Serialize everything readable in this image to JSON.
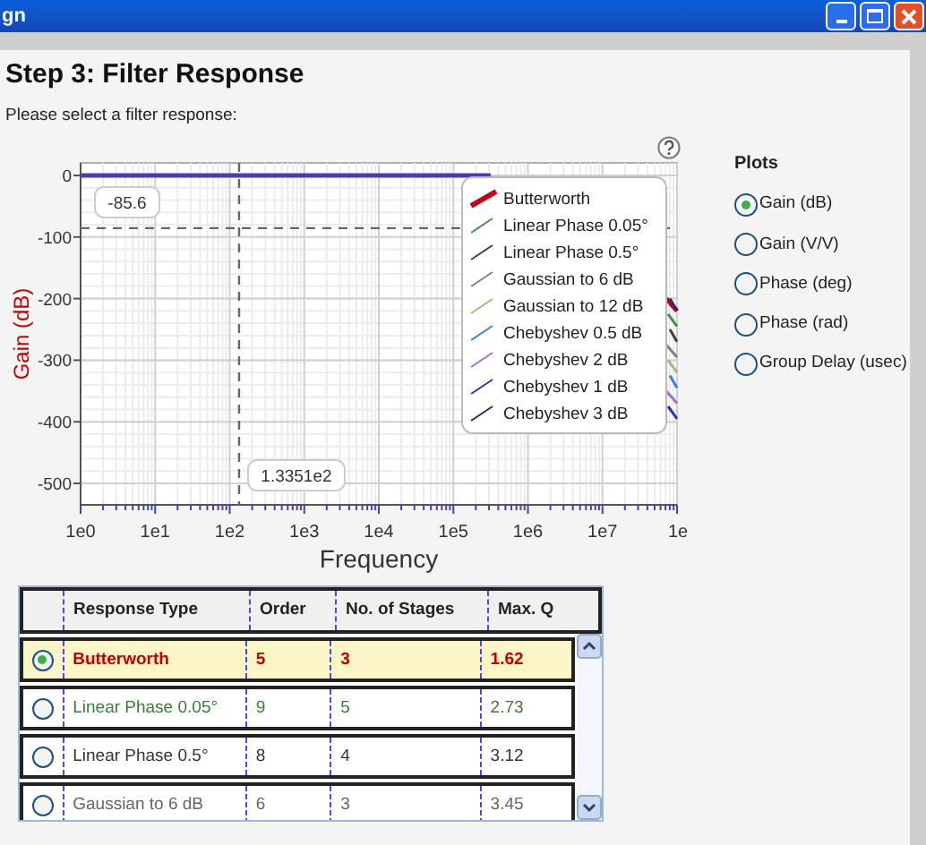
{
  "window": {
    "title": "gn"
  },
  "step_title": "Step 3: Filter Response",
  "instruction": "Please select a filter response:",
  "plot": {
    "xlabel": "Frequency",
    "ylabel": "Gain (dB)",
    "x_ticks": [
      "1e0",
      "1e1",
      "1e2",
      "1e3",
      "1e4",
      "1e5",
      "1e6",
      "1e7",
      "1e"
    ],
    "y_ticks": [
      "0",
      "-100",
      "-200",
      "-300",
      "-400",
      "-500"
    ],
    "cursor_labels": [
      "1.3351e2",
      "-85.6"
    ],
    "legend": [
      {
        "name": "Butterworth",
        "color": "#c0001a"
      },
      {
        "name": "Linear Phase 0.05°",
        "color": "#4f8a4f"
      },
      {
        "name": "Linear Phase 0.5°",
        "color": "#404040"
      },
      {
        "name": "Gaussian to 6 dB",
        "color": "#808080"
      },
      {
        "name": "Gaussian to 12 dB",
        "color": "#b8ad80"
      },
      {
        "name": "Chebyshev 0.5 dB",
        "color": "#3a7de0"
      },
      {
        "name": "Chebyshev 2 dB",
        "color": "#a070d0"
      },
      {
        "name": "Chebyshev 1 dB",
        "color": "#3030c0"
      },
      {
        "name": "Chebyshev 3 dB",
        "color": "#2a2a70"
      }
    ]
  },
  "plots": {
    "title": "Plots",
    "options": [
      {
        "label": "Gain (dB)",
        "selected": true
      },
      {
        "label": "Gain (V/V)",
        "selected": false
      },
      {
        "label": "Phase (deg)",
        "selected": false
      },
      {
        "label": "Phase (rad)",
        "selected": false
      },
      {
        "label": "Group Delay (usec)",
        "selected": false
      }
    ]
  },
  "table": {
    "columns": [
      "Response Type",
      "Order",
      "No. of Stages",
      "Max. Q"
    ],
    "rows": [
      {
        "selected": true,
        "color": "#c00000",
        "cells": [
          "Butterworth",
          "5",
          "3",
          "1.62"
        ]
      },
      {
        "selected": false,
        "color": "#3a7a3a",
        "cells": [
          "Linear Phase 0.05°",
          "9",
          "5",
          "2.73"
        ]
      },
      {
        "selected": false,
        "color": "#333333",
        "cells": [
          "Linear Phase 0.5°",
          "8",
          "4",
          "3.12"
        ]
      },
      {
        "selected": false,
        "color": "#666666",
        "cells": [
          "Gaussian to 6 dB",
          "6",
          "3",
          "3.45"
        ]
      }
    ]
  }
}
